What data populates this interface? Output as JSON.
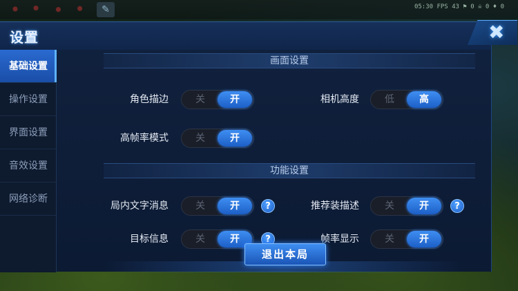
{
  "topbar": {
    "status_text": "05:30  FPS 43  ⚑ 0  ☠ 0  ♦ 0",
    "tool_icon": "wrench-icon"
  },
  "panel": {
    "title": "设置",
    "close_icon": "close-icon"
  },
  "sidebar": {
    "items": [
      {
        "label": "基础设置",
        "active": true
      },
      {
        "label": "操作设置",
        "active": false
      },
      {
        "label": "界面设置",
        "active": false
      },
      {
        "label": "音效设置",
        "active": false
      },
      {
        "label": "网络诊断",
        "active": false
      }
    ]
  },
  "sections": {
    "display": {
      "title": "画面设置"
    },
    "function": {
      "title": "功能设置"
    }
  },
  "settings": {
    "outline": {
      "label": "角色描边",
      "off": "关",
      "on": "开",
      "value": "开"
    },
    "camera": {
      "label": "相机高度",
      "off": "低",
      "on": "高",
      "value": "高"
    },
    "hfr": {
      "label": "高帧率模式",
      "off": "关",
      "on": "开",
      "value": "开"
    },
    "chat": {
      "label": "局内文字消息",
      "off": "关",
      "on": "开",
      "value": "开"
    },
    "recommend": {
      "label": "推荐装描述",
      "off": "关",
      "on": "开",
      "value": "开"
    },
    "target": {
      "label": "目标信息",
      "off": "关",
      "on": "开",
      "value": "开"
    },
    "fps": {
      "label": "帧率显示",
      "off": "关",
      "on": "开",
      "value": "开"
    }
  },
  "help_label": "?",
  "exit_button": "退出本局",
  "colors": {
    "accent": "#2f85ff",
    "panel": "#0c1a33",
    "sidebar_active": "#1a4ea8"
  }
}
